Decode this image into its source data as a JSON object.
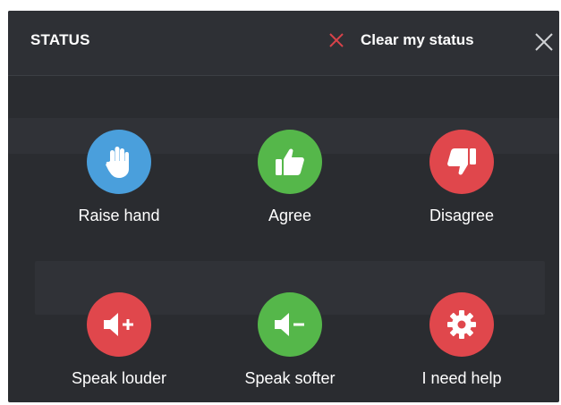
{
  "header": {
    "title": "STATUS",
    "clear_label": "Clear my status"
  },
  "statuses": [
    {
      "label": "Raise hand",
      "icon": "hand-icon",
      "color": "#4a9fdc"
    },
    {
      "label": "Agree",
      "icon": "thumbs-up-icon",
      "color": "#55b74a"
    },
    {
      "label": "Disagree",
      "icon": "thumbs-down-icon",
      "color": "#e0474c"
    },
    {
      "label": "Speak louder",
      "icon": "volume-up-icon",
      "color": "#e0474c"
    },
    {
      "label": "Speak softer",
      "icon": "volume-down-icon",
      "color": "#55b74a"
    },
    {
      "label": "I need help",
      "icon": "gear-icon",
      "color": "#e0474c"
    }
  ],
  "colors": {
    "panel_bg": "#2a2c30",
    "clear_x": "#d9434a",
    "text": "#ffffff"
  }
}
